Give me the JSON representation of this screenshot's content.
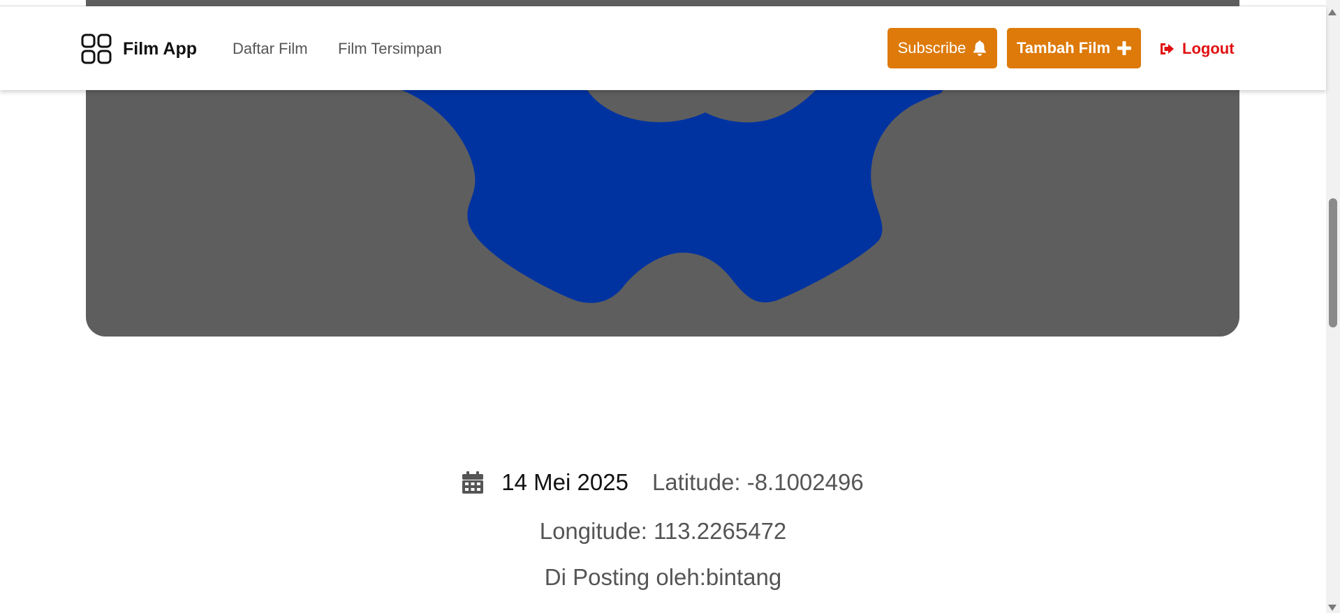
{
  "navbar": {
    "brand": "Film App",
    "links": [
      "Daftar Film",
      "Film Tersimpan"
    ],
    "subscribe_label": "Subscribe",
    "tambah_label": "Tambah Film",
    "logout_label": "Logout"
  },
  "hero": {
    "background_color": "#5e5e5e",
    "shape_color": "#0033a0"
  },
  "meta": {
    "date": "14 Mei 2025",
    "latitude": "Latitude: -8.1002496",
    "longitude": "Longitude: 113.2265472",
    "posted_by": "Di Posting oleh:bintang"
  },
  "colors": {
    "accent": "#dd7a0a",
    "logout": "#e01010"
  },
  "icons": [
    "grid-icon",
    "bell-icon",
    "plus-icon",
    "sign-out-icon",
    "calendar-icon"
  ]
}
